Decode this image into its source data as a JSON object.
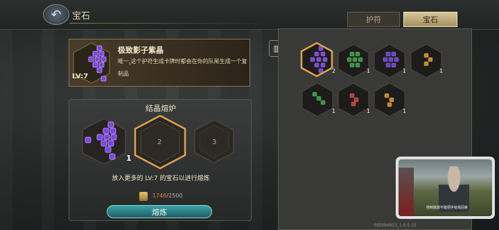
{
  "header": {
    "title": "宝石"
  },
  "tabs": [
    {
      "label": "护符",
      "active": false
    },
    {
      "label": "宝石",
      "active": true
    }
  ],
  "detail": {
    "name": "极致影子紫晶",
    "level": "LV:7",
    "desc_prefix": "唯一",
    "desc_marker": "s",
    "desc_rest": "这个护符生成卡牌时都会在你的队尾生成一个复制品"
  },
  "furnace": {
    "title": "结晶熔炉",
    "slots": [
      {
        "count": "1"
      },
      {
        "number": "2"
      },
      {
        "number": "3"
      }
    ],
    "instruction": "放入更多的 LV:7 的宝石以进行熔炼",
    "cost_have": "1746",
    "cost_need": "/2500",
    "button": "熔炼"
  },
  "inventory": {
    "items": [
      {
        "color": "#7a45e6",
        "count": "2",
        "selected": true
      },
      {
        "color": "#2e9a3c",
        "count": "1",
        "selected": false
      },
      {
        "color": "#6a3fd6",
        "count": "1",
        "selected": false
      },
      {
        "color": "#c98a1e",
        "count": "1",
        "selected": false
      },
      {
        "color": "#2e9a3c",
        "count": "1",
        "selected": false
      },
      {
        "color": "#c23a28",
        "count": "1",
        "selected": false
      },
      {
        "color": "#c98a1e",
        "count": "1",
        "selected": false
      }
    ]
  },
  "video": {
    "subtitle": "他到底能不能把手给找回来"
  },
  "footer": {
    "version": "PID394923_1.0.5.15"
  },
  "colors": {
    "accent_gold": "#d7c69a",
    "button_teal": "#2a8a8f",
    "purple_gem": "#7a45e6"
  }
}
